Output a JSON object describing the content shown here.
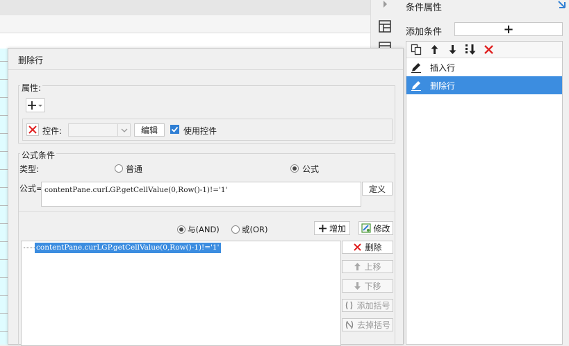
{
  "right_panel": {
    "title": "条件属性",
    "add_condition_label": "添加条件",
    "add_condition_button": "+",
    "conditions": [
      {
        "label": "插入行",
        "selected": false
      },
      {
        "label": "删除行",
        "selected": true
      }
    ]
  },
  "dialog": {
    "title": "删除行",
    "properties": {
      "label": "属性:",
      "control_label": "控件:",
      "edit_button": "编辑",
      "use_control_label": "使用控件",
      "use_control_checked": true
    },
    "formula_condition": {
      "group_label": "公式条件",
      "type_label": "类型:",
      "type_normal": "普通",
      "type_formula": "公式",
      "selected_type": "公式",
      "formula_label": "公式=",
      "formula_value": "contentPane.curLGP.getCellValue(0,Row()-1)!='1'",
      "define_button": "定义",
      "and_label": "与(AND)",
      "or_label": "或(OR)",
      "add_button": "增加",
      "modify_button": "修改",
      "expressions": [
        "contentPane.curLGP.getCellValue(0,Row()-1)!='1'"
      ],
      "delete_button": "删除",
      "move_up_button": "上移",
      "move_down_button": "下移",
      "add_bracket_button": "添加括号",
      "remove_bracket_button": "去掉括号"
    }
  },
  "colors": {
    "accent": "#3c8de0",
    "delete_red": "#e02020",
    "cell_fill": "#dffcff"
  }
}
